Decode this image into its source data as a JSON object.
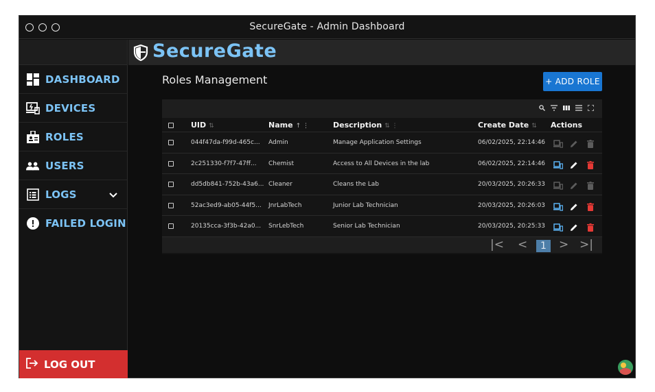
{
  "window": {
    "title": "SecureGate - Admin Dashboard"
  },
  "brand": {
    "name": "SecureGate"
  },
  "sidebar": {
    "items": [
      {
        "label": "DASHBOARD",
        "icon": "dashboard-icon"
      },
      {
        "label": "DEVICES",
        "icon": "devices-icon"
      },
      {
        "label": "ROLES",
        "icon": "badge-icon"
      },
      {
        "label": "USERS",
        "icon": "group-icon"
      },
      {
        "label": "LOGS",
        "icon": "list-icon",
        "expandable": true
      },
      {
        "label": "FAILED LOGIN",
        "icon": "alert-icon"
      }
    ],
    "logout_label": "LOG OUT"
  },
  "main": {
    "title": "Roles Management",
    "add_button": "+ ADD ROLE",
    "table": {
      "columns": [
        {
          "label": "UID",
          "sort": "⇅"
        },
        {
          "label": "Name",
          "sort": "↑   ⋮"
        },
        {
          "label": "Description",
          "sort": "⇅   ⋮"
        },
        {
          "label": "Create Date",
          "sort": "⇅"
        },
        {
          "label": "Actions",
          "sort": ""
        }
      ],
      "rows": [
        {
          "uid": "044f47da-f99d-465c...",
          "name": "Admin",
          "description": "Manage Application Settings",
          "created": "06/02/2025, 22:14:46",
          "actions_enabled": false
        },
        {
          "uid": "2c251330-f7f7-47ff...",
          "name": "Chemist",
          "description": "Access to All Devices in the lab",
          "created": "06/02/2025, 22:14:46",
          "actions_enabled": true
        },
        {
          "uid": "dd5db841-752b-43a6...",
          "name": "Cleaner",
          "description": "Cleans the Lab",
          "created": "20/03/2025, 20:26:33",
          "actions_enabled": false
        },
        {
          "uid": "52ac3ed9-ab05-44f5...",
          "name": "JnrLabTech",
          "description": "Junior Lab Technician",
          "created": "20/03/2025, 20:26:03",
          "actions_enabled": true
        },
        {
          "uid": "20135cca-3f3b-42a0...",
          "name": "SnrLebTech",
          "description": "Senior Lab Technician",
          "created": "20/03/2025, 20:25:33",
          "actions_enabled": true
        }
      ]
    },
    "pagination": {
      "current_page": "1"
    }
  },
  "colors": {
    "accent": "#7cc3f5",
    "primary_button": "#1976d2",
    "danger": "#d32f2f"
  }
}
